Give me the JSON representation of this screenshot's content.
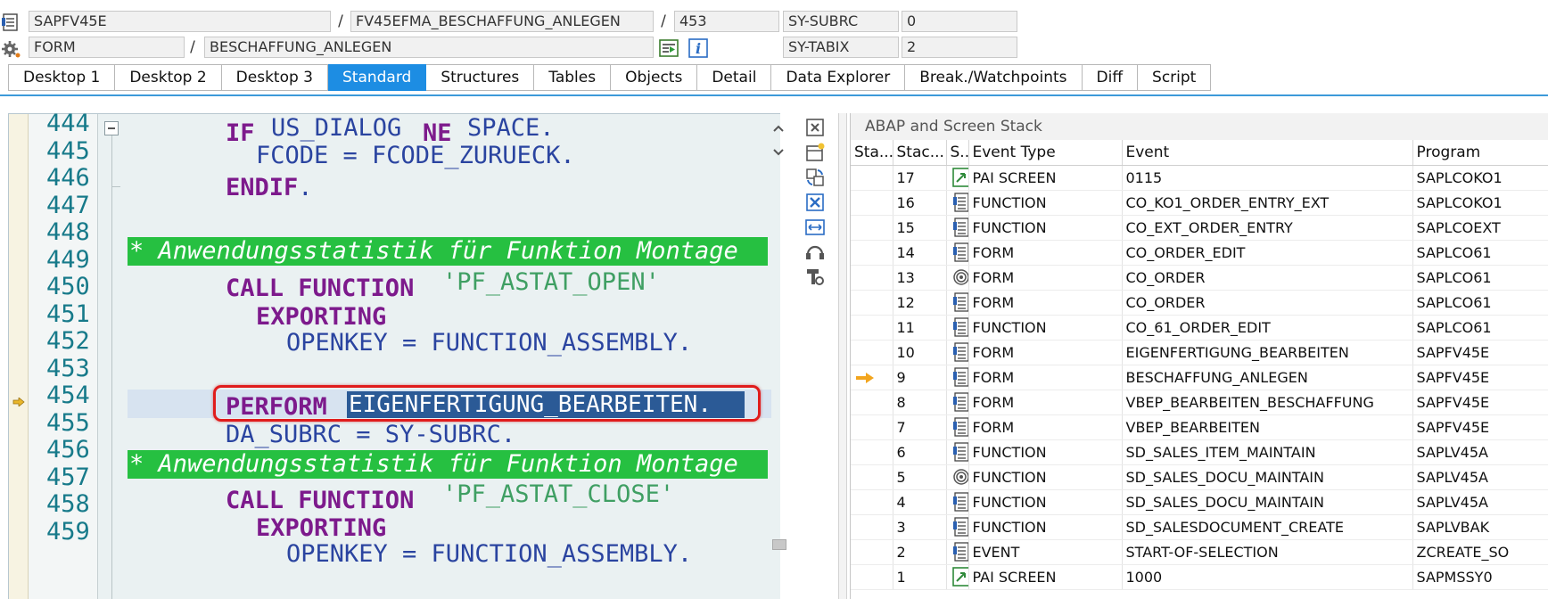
{
  "header": {
    "program": "SAPFV45E",
    "include": "FV45EFMA_BESCHAFFUNG_ANLEGEN",
    "line": "453",
    "block_type": "FORM",
    "block_name": "BESCHAFFUNG_ANLEGEN",
    "sep1": "/",
    "sep2": "/",
    "sep3": "/",
    "sys_fields": [
      {
        "name": "SY-SUBRC",
        "value": "0"
      },
      {
        "name": "SY-TABIX",
        "value": "2"
      }
    ],
    "icons": [
      "program-icon",
      "settings-icon",
      "display-object-icon",
      "info-icon"
    ]
  },
  "tabs": [
    {
      "label": "Desktop 1",
      "active": false
    },
    {
      "label": "Desktop 2",
      "active": false
    },
    {
      "label": "Desktop 3",
      "active": false
    },
    {
      "label": "Standard",
      "active": true
    },
    {
      "label": "Structures",
      "active": false
    },
    {
      "label": "Tables",
      "active": false
    },
    {
      "label": "Objects",
      "active": false
    },
    {
      "label": "Detail",
      "active": false
    },
    {
      "label": "Data Explorer",
      "active": false
    },
    {
      "label": "Break./Watchpoints",
      "active": false
    },
    {
      "label": "Diff",
      "active": false
    },
    {
      "label": "Script",
      "active": false
    }
  ],
  "code": {
    "line_numbers": [
      "444",
      "445",
      "446",
      "447",
      "448",
      "449",
      "450",
      "451",
      "452",
      "453",
      "454",
      "455",
      "456",
      "457",
      "458",
      "459"
    ],
    "current_line": "453",
    "lines": {
      "l444_kw1": "IF",
      "l444_a": "US_DIALOG",
      "l444_kw2": "NE",
      "l444_b": "SPACE.",
      "l445": "FCODE = FCODE_ZURUECK.",
      "l446_kw": "ENDIF",
      "l446_dot": ".",
      "l448_comment": "* Anwendungsstatistik für Funktion Montage",
      "l449_kw": "CALL FUNCTION",
      "l449_str": "'PF_ASTAT_OPEN'",
      "l450_kw": "EXPORTING",
      "l451": "OPENKEY = FUNCTION_ASSEMBLY.",
      "l453_kw": "PERFORM",
      "l453_sel": "EIGENFERTIGUNG_BEARBEITEN.",
      "l454": "DA_SUBRC = SY-SUBRC.",
      "l455_comment": "* Anwendungsstatistik für Funktion Montage",
      "l456_kw": "CALL FUNCTION",
      "l456_str": "'PF_ASTAT_CLOSE'",
      "l457_kw": "EXPORTING",
      "l458": "OPENKEY = FUNCTION_ASSEMBLY."
    },
    "colors": {
      "keyword": "#7d1a8c",
      "text": "#2a44a0",
      "string": "#3f9f63",
      "comment_bg": "#26c041",
      "selection": "#2b5a96",
      "highlight": "#e01c1c"
    }
  },
  "toolbar_icons": [
    "stop-icon",
    "new-tool-icon",
    "replace-tool-icon",
    "close-tool-icon",
    "maximize-tool-icon",
    "exchange-icon",
    "tool-services-icon"
  ],
  "stack": {
    "title": "ABAP and Screen Stack",
    "columns": [
      "Sta...",
      "Stac...",
      "S...",
      "Event Type",
      "Event",
      "Program"
    ],
    "rows": [
      {
        "level": "17",
        "icon": "screen",
        "type": "PAI SCREEN",
        "event": "0115",
        "program": "SAPLCOKO1",
        "current": false
      },
      {
        "level": "16",
        "icon": "doc",
        "type": "FUNCTION",
        "event": "CO_KO1_ORDER_ENTRY_EXT",
        "program": "SAPLCOKO1",
        "current": false
      },
      {
        "level": "15",
        "icon": "doc",
        "type": "FUNCTION",
        "event": "CO_EXT_ORDER_ENTRY",
        "program": "SAPLCOEXT",
        "current": false
      },
      {
        "level": "14",
        "icon": "doc",
        "type": "FORM",
        "event": "CO_ORDER_EDIT",
        "program": "SAPLCO61",
        "current": false
      },
      {
        "level": "13",
        "icon": "cycle",
        "type": "FORM",
        "event": "CO_ORDER",
        "program": "SAPLCO61",
        "current": false
      },
      {
        "level": "12",
        "icon": "doc",
        "type": "FORM",
        "event": "CO_ORDER",
        "program": "SAPLCO61",
        "current": false
      },
      {
        "level": "11",
        "icon": "doc",
        "type": "FUNCTION",
        "event": "CO_61_ORDER_EDIT",
        "program": "SAPLCO61",
        "current": false
      },
      {
        "level": "10",
        "icon": "doc",
        "type": "FORM",
        "event": "EIGENFERTIGUNG_BEARBEITEN",
        "program": "SAPFV45E",
        "current": false
      },
      {
        "level": "9",
        "icon": "doc",
        "type": "FORM",
        "event": "BESCHAFFUNG_ANLEGEN",
        "program": "SAPFV45E",
        "current": true
      },
      {
        "level": "8",
        "icon": "doc",
        "type": "FORM",
        "event": "VBEP_BEARBEITEN_BESCHAFFUNG",
        "program": "SAPFV45E",
        "current": false
      },
      {
        "level": "7",
        "icon": "doc",
        "type": "FORM",
        "event": "VBEP_BEARBEITEN",
        "program": "SAPFV45E",
        "current": false
      },
      {
        "level": "6",
        "icon": "doc",
        "type": "FUNCTION",
        "event": "SD_SALES_ITEM_MAINTAIN",
        "program": "SAPLV45A",
        "current": false
      },
      {
        "level": "5",
        "icon": "cycle",
        "type": "FUNCTION",
        "event": "SD_SALES_DOCU_MAINTAIN",
        "program": "SAPLV45A",
        "current": false
      },
      {
        "level": "4",
        "icon": "doc",
        "type": "FUNCTION",
        "event": "SD_SALES_DOCU_MAINTAIN",
        "program": "SAPLV45A",
        "current": false
      },
      {
        "level": "3",
        "icon": "doc",
        "type": "FUNCTION",
        "event": "SD_SALESDOCUMENT_CREATE",
        "program": "SAPLVBAK",
        "current": false
      },
      {
        "level": "2",
        "icon": "doc",
        "type": "EVENT",
        "event": "START-OF-SELECTION",
        "program": "ZCREATE_SO",
        "current": false
      },
      {
        "level": "1",
        "icon": "screen",
        "type": "PAI SCREEN",
        "event": "1000",
        "program": "SAPMSSY0",
        "current": false
      }
    ],
    "current_arrow_color": "#f2a51e"
  }
}
